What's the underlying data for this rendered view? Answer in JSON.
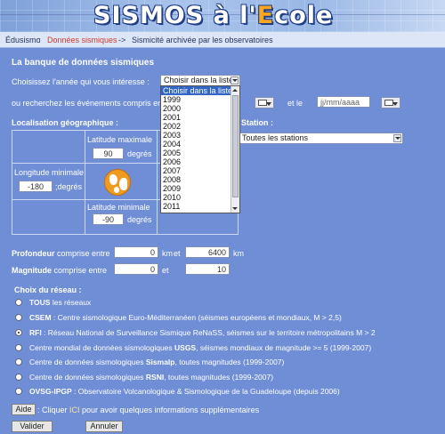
{
  "banner": {
    "title_main": "SISMOS à l'",
    "title_e": "E",
    "title_rest": "cole"
  },
  "breadcrumb": {
    "home": "Édusismo",
    "sep": " : ",
    "data_link": "Données sismiques",
    "arrow": " -> ",
    "current": "Sismicité archivée par les observatoires"
  },
  "form": {
    "heading": "La banque de données sismiques",
    "year_label": "Choisissez l'année qui vous intéresse :",
    "year_select": {
      "value": "Choisir dans la liste",
      "options": [
        "Choisir dans la liste",
        "1999",
        "2000",
        "2001",
        "2002",
        "2003",
        "2004",
        "2005",
        "2006",
        "2007",
        "2008",
        "2009",
        "2010",
        "2011"
      ]
    },
    "between_label": "ou recherchez les événements compris en",
    "and_label": "et le",
    "date_placeholder": "jj/mm/aaaa",
    "geo_heading": "Localisation géographique :",
    "station_heading": "Station :",
    "station_select": "Toutes les stations",
    "lat_max_label": "Latitude maximale",
    "lat_max_value": "90",
    "lon_min_label": "Longitude minimale",
    "lon_min_value": "-180",
    "lat_min_label": "Latitude minimale",
    "lat_min_value": "-90",
    "degrees": "degrés",
    "degrees_semi": ";degrés",
    "depth_label_bold": "Profondeur",
    "depth_label_rest": " comprise entre",
    "depth_min": "0",
    "km": "km",
    "et": "et",
    "depth_max": "6400",
    "mag_label_bold": "Magnitude",
    "mag_label_rest": " comprise entre",
    "mag_min": "0",
    "mag_max": "10",
    "network_heading": "Choix du réseau :",
    "networks": [
      {
        "bold": "TOUS",
        "text": " les réseaux",
        "checked": false
      },
      {
        "bold": "CSEM",
        "text": " : Centre sismologique Euro-Méditerranéen (séismes européens et mondiaux, M > 2,5)",
        "checked": false
      },
      {
        "bold": "RFI",
        "text": " : Réseau National de Surveillance Sismique ReNaSS, séismes sur le territoire métropolitains M > 2",
        "checked": true
      },
      {
        "pre": "Centre mondial de données sismologiques ",
        "bold": "USGS",
        "text": ", séismes mondiaux de magnitude >= 5 (1999-2007)",
        "checked": false
      },
      {
        "pre": "Centre de données sismologiques ",
        "bold": "Sismalp",
        "text": ", toutes magnitudes (1999-2007)",
        "checked": false
      },
      {
        "pre": "Centre de données sismologiques ",
        "bold": "RSNI",
        "text": ", toutes magnitudes (1999-2007)",
        "checked": false
      },
      {
        "bold": "OVSG-IPGP",
        "text": " : Observatoire Volcanologique & Sismologique de la Guadeloupe (depuis 2006)",
        "checked": false
      }
    ],
    "help_button": "Aide",
    "help_text_pre": " : Cliquer ",
    "help_link": "ICI",
    "help_text_post": " pour avoir quelques informations supplémentaires",
    "submit_button": "Valider",
    "cancel_button": "Annuler"
  }
}
